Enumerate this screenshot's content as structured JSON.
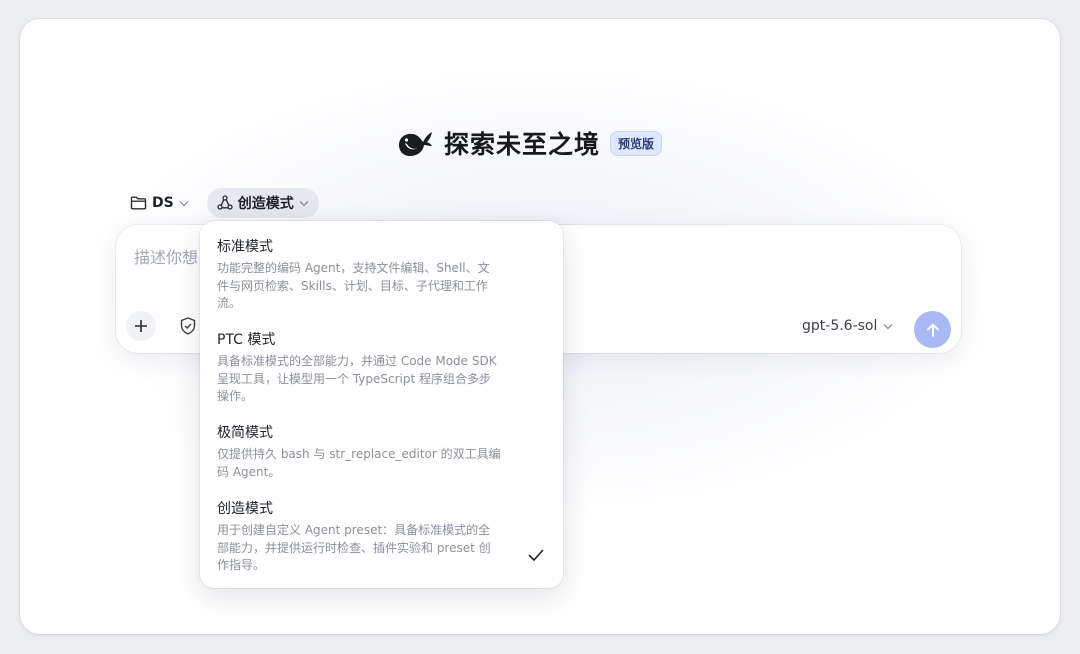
{
  "brand": {
    "title": "探索未至之境",
    "badge": "预览版",
    "logo_icon": "whale-logo-icon"
  },
  "toolbar": {
    "folder": {
      "icon": "folder-icon",
      "label": "DS"
    },
    "mode": {
      "icon": "mode-icon",
      "label": "创造模式"
    }
  },
  "composer": {
    "placeholder": "描述你想",
    "add_icon": "plus-icon",
    "shield_icon": "shield-icon",
    "model": "gpt-5.6-sol",
    "send_icon": "arrow-up-icon"
  },
  "mode_menu": {
    "selected_index": 3,
    "options": [
      {
        "title": "标准模式",
        "desc_lines": [
          "功能完整的编码 Agent，支持文件编辑、Shell、文",
          "件与网页检索、Skills、计划、目标、子代理和工作",
          "流。"
        ]
      },
      {
        "title": "PTC 模式",
        "desc_lines": [
          "具备标准模式的全部能力，并通过 Code Mode SDK",
          "呈现工具，让模型用一个 TypeScript 程序组合多步",
          "操作。"
        ]
      },
      {
        "title": "极简模式",
        "desc_lines": [
          "仅提供持久 bash 与 str_replace_editor 的双工具编",
          "码 Agent。"
        ]
      },
      {
        "title": "创造模式",
        "desc_lines": [
          "用于创建自定义 Agent preset：具备标准模式的全",
          "部能力，并提供运行时检查、插件实验和 preset 创",
          "作指导。"
        ]
      }
    ]
  },
  "colors": {
    "accent": "#a9b9f4",
    "badge_bg": "#dfe8ff",
    "badge_text": "#2d3e75"
  }
}
